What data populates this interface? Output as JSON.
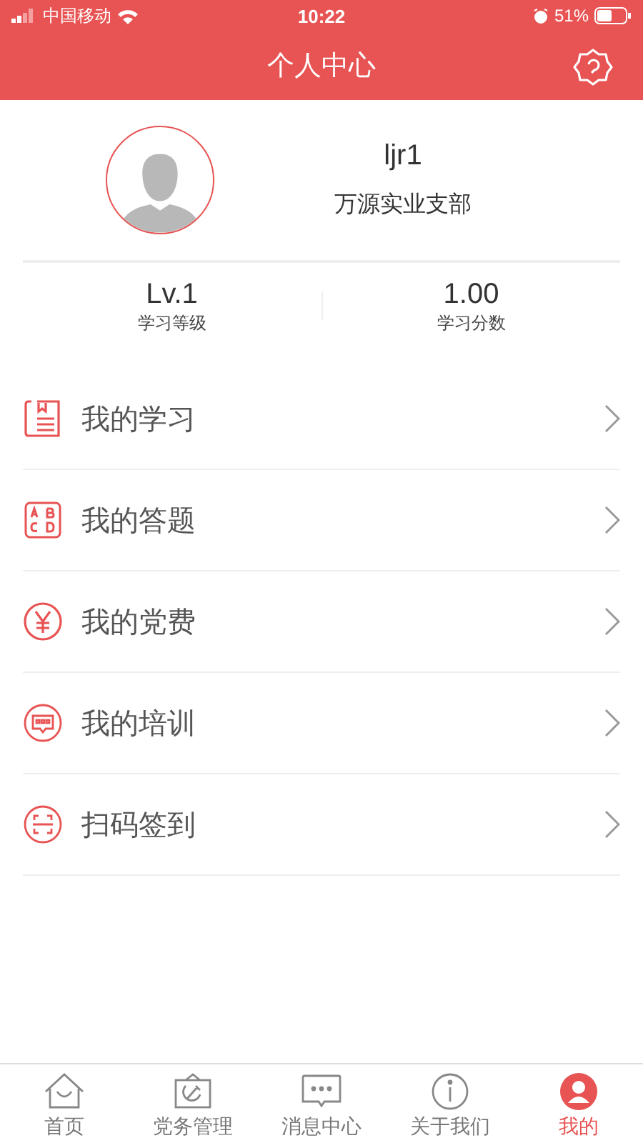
{
  "status_bar": {
    "carrier": "中国移动",
    "time": "10:22",
    "battery": "51%"
  },
  "nav_bar": {
    "title": "个人中心"
  },
  "profile": {
    "username": "ljr1",
    "branch": "万源实业支部"
  },
  "stats": [
    {
      "value": "Lv.1",
      "label": "学习等级"
    },
    {
      "value": "1.00",
      "label": "学习分数"
    }
  ],
  "menu": [
    {
      "kind": "book",
      "label": "我的学习"
    },
    {
      "kind": "quiz",
      "label": "我的答题"
    },
    {
      "kind": "fee",
      "label": "我的党费"
    },
    {
      "kind": "training",
      "label": "我的培训"
    },
    {
      "kind": "scan",
      "label": "扫码签到"
    }
  ],
  "tab_bar": [
    {
      "kind": "home",
      "label": "首页",
      "selected": false
    },
    {
      "kind": "party",
      "label": "党务管理",
      "selected": false
    },
    {
      "kind": "message",
      "label": "消息中心",
      "selected": false
    },
    {
      "kind": "about",
      "label": "关于我们",
      "selected": false
    },
    {
      "kind": "me",
      "label": "我的",
      "selected": true
    }
  ]
}
